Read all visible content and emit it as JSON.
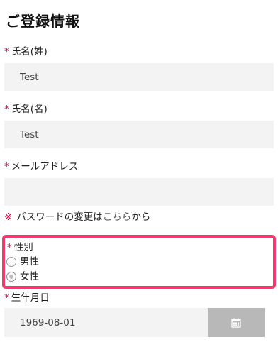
{
  "section": {
    "title": "ご登録情報"
  },
  "required_mark": "*",
  "fields": {
    "last_name": {
      "label": "氏名(姓)",
      "value": "Test"
    },
    "first_name": {
      "label": "氏名(名)",
      "value": "Test"
    },
    "email": {
      "label": "メールアドレス",
      "value": ""
    }
  },
  "password_note": {
    "mark": "※",
    "before": "パスワードの変更は",
    "link": "こちら",
    "after": "から"
  },
  "gender": {
    "label": "性別",
    "options": [
      {
        "label": "男性",
        "checked": false
      },
      {
        "label": "女性",
        "checked": true
      }
    ],
    "highlight_color": "#f23a6e"
  },
  "birthday": {
    "label": "生年月日",
    "value": "1969-08-01",
    "button_icon": "calendar-icon"
  },
  "colors": {
    "required": "#e5003b",
    "input_bg": "#f3f3f3",
    "calendar_button": "#b8b8b8"
  }
}
